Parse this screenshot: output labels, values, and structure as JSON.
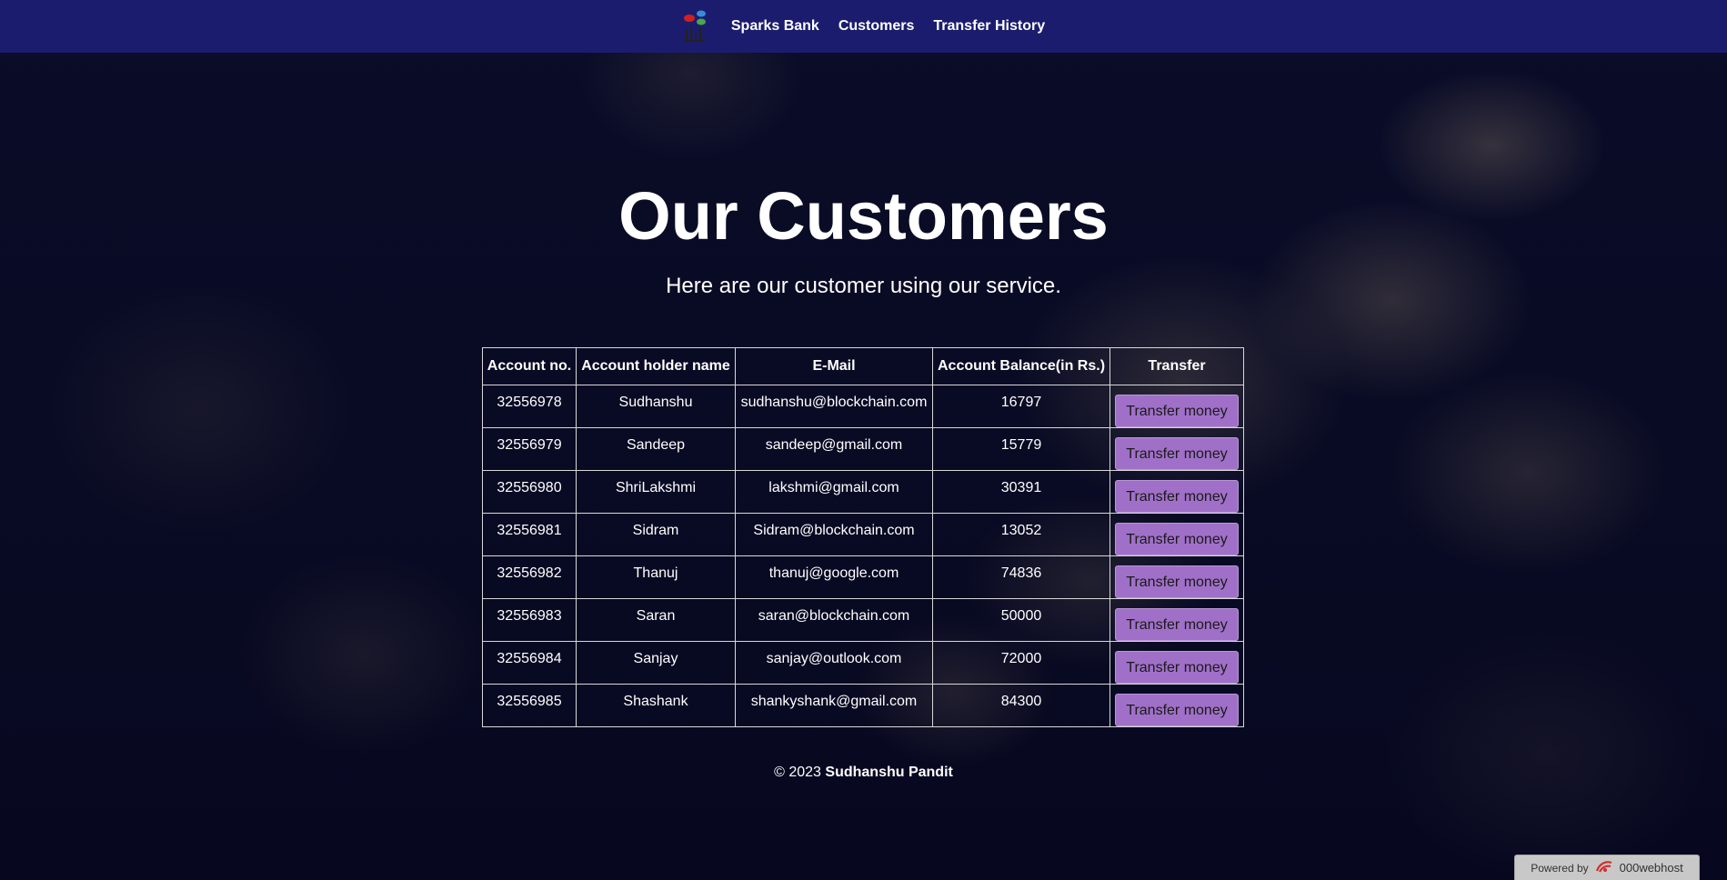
{
  "nav": {
    "brand": "Sparks Bank",
    "links": [
      "Customers",
      "Transfer History"
    ]
  },
  "hero": {
    "title": "Our Customers",
    "subtitle": "Here are our customer using our service."
  },
  "table": {
    "headers": [
      "Account no.",
      "Account holder name",
      "E-Mail",
      "Account Balance(in Rs.)",
      "Transfer"
    ],
    "rows": [
      {
        "account": "32556978",
        "name": "Sudhanshu",
        "email": "sudhanshu@blockchain.com",
        "balance": "16797",
        "action": "Transfer money"
      },
      {
        "account": "32556979",
        "name": "Sandeep",
        "email": "sandeep@gmail.com",
        "balance": "15779",
        "action": "Transfer money"
      },
      {
        "account": "32556980",
        "name": "ShriLakshmi",
        "email": "lakshmi@gmail.com",
        "balance": "30391",
        "action": "Transfer money"
      },
      {
        "account": "32556981",
        "name": "Sidram",
        "email": "Sidram@blockchain.com",
        "balance": "13052",
        "action": "Transfer money"
      },
      {
        "account": "32556982",
        "name": "Thanuj",
        "email": "thanuj@google.com",
        "balance": "74836",
        "action": "Transfer money"
      },
      {
        "account": "32556983",
        "name": "Saran",
        "email": "saran@blockchain.com",
        "balance": "50000",
        "action": "Transfer money"
      },
      {
        "account": "32556984",
        "name": "Sanjay",
        "email": "sanjay@outlook.com",
        "balance": "72000",
        "action": "Transfer money"
      },
      {
        "account": "32556985",
        "name": "Shashank",
        "email": "shankyshank@gmail.com",
        "balance": "84300",
        "action": "Transfer money"
      }
    ]
  },
  "footer": {
    "prefix": "© 2023",
    "author": "Sudhanshu Pandit"
  },
  "badge": {
    "label": "Powered by",
    "host": "000webhost"
  },
  "icons": {
    "logo": "bank-tree-logo-icon",
    "badge_logo": "webhost-logo-icon"
  },
  "colors": {
    "navbar": "#1c1c6e",
    "button": "#a070c8",
    "background": "#0a0c28"
  }
}
